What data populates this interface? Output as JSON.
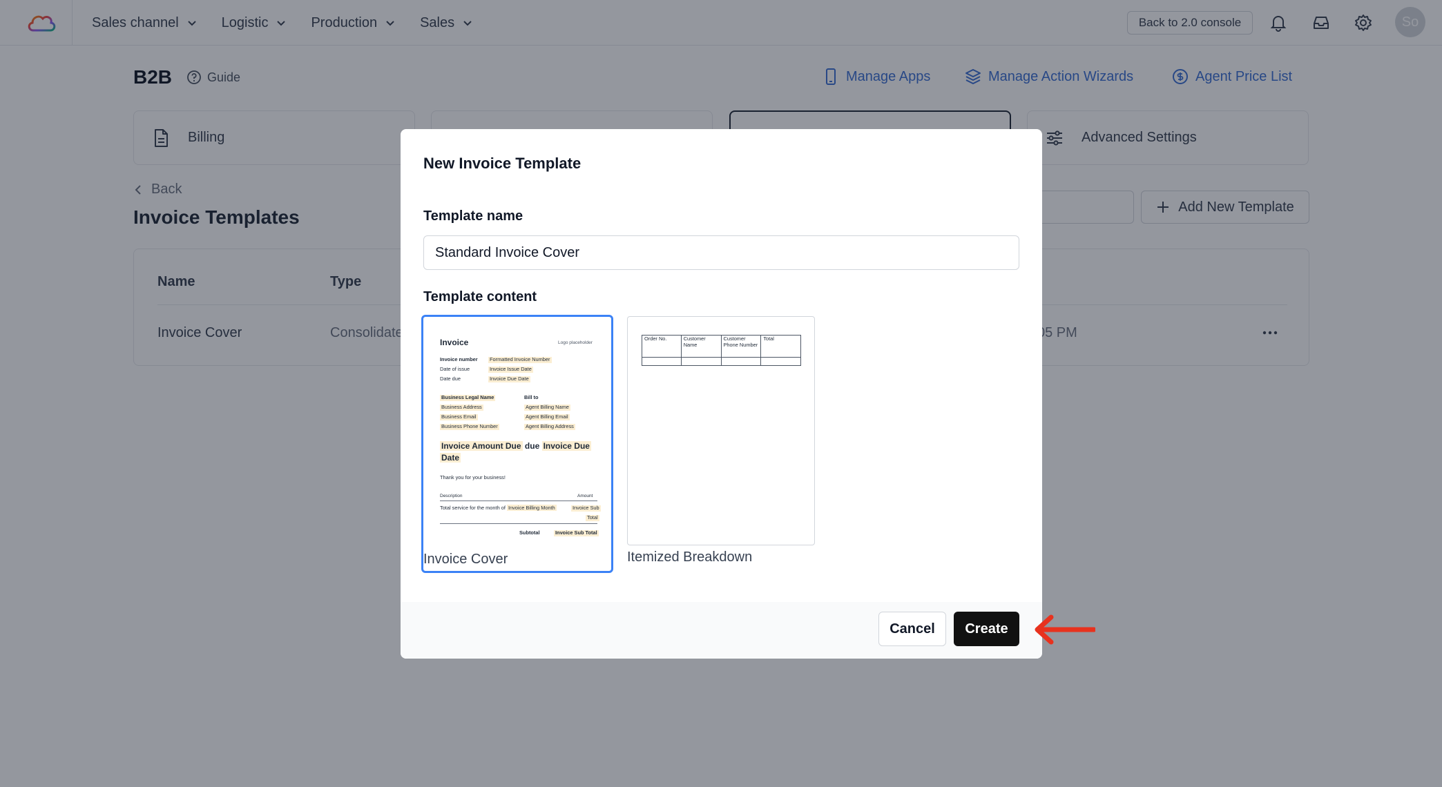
{
  "topbar": {
    "nav": [
      {
        "label": "Sales channel"
      },
      {
        "label": "Logistic"
      },
      {
        "label": "Production"
      },
      {
        "label": "Sales"
      }
    ],
    "back_console": "Back to 2.0 console",
    "avatar_initials": "So"
  },
  "page": {
    "title": "B2B",
    "guide": "Guide",
    "links": {
      "manage_apps": "Manage Apps",
      "manage_action_wizards": "Manage Action Wizards",
      "agent_price_list": "Agent Price List"
    },
    "tabs": [
      {
        "label": "Billing",
        "icon": "document-icon"
      },
      {
        "label": "",
        "icon": ""
      },
      {
        "label": "",
        "icon": ""
      },
      {
        "label": "Advanced Settings",
        "icon": "sliders-icon"
      }
    ],
    "back": "Back",
    "section_title": "Invoice Templates",
    "add_template": "Add New Template",
    "table": {
      "columns": [
        "Name",
        "Type"
      ],
      "rows": [
        {
          "name": "Invoice Cover",
          "type": "Consolidate",
          "time": "05 PM"
        }
      ]
    }
  },
  "modal": {
    "title": "New Invoice Template",
    "name_label": "Template name",
    "name_value": "Standard Invoice Cover",
    "content_label": "Template content",
    "options": [
      {
        "label": "Invoice Cover",
        "selected": true
      },
      {
        "label": "Itemized Breakdown",
        "selected": false
      }
    ],
    "cancel": "Cancel",
    "create": "Create"
  },
  "invoice_preview": {
    "title": "Invoice",
    "logo_placeholder": "Logo placeholder",
    "invoice_number_label": "Invoice number",
    "invoice_number_value": "Formatted Invoice Number",
    "date_issue_label": "Date of issue",
    "date_issue_value": "Invoice Issue Date",
    "date_due_label": "Date due",
    "date_due_value": "Invoice Due Date",
    "business_legal_name": "Business Legal Name",
    "business_address": "Business Address",
    "business_email": "Business Email",
    "business_phone": "Business Phone Number",
    "bill_to": "Bill to",
    "agent_billing_name": "Agent Billing Name",
    "agent_billing_email": "Agent Billing Email",
    "agent_billing_address": "Agent Billing Address",
    "amount_due_1": "Invoice Amount Due",
    "due_word": " due ",
    "amount_due_2": "Invoice Due",
    "amount_due_3": "Date",
    "thanks": "Thank you for your business!",
    "desc_header": "Description",
    "amount_header": "Amount",
    "service_text": "Total service for the month of ",
    "billing_month": "Invoice Billing Month",
    "sub_total_a": "Invoice Sub",
    "sub_total_b": "Total",
    "subtotal_label": "Subtotal",
    "subtotal_value": "Invoice Sub Total"
  },
  "itemized_preview": {
    "headers": [
      "Order No.",
      "Customer Name",
      "Customer Phone Number",
      "Total"
    ]
  },
  "colors": {
    "accent_blue": "#3b82f6",
    "link_blue": "#3b6fd4",
    "primary_button": "#111111",
    "annotation_arrow": "#e8321e",
    "placeholder_highlight": "#fbeed2"
  }
}
